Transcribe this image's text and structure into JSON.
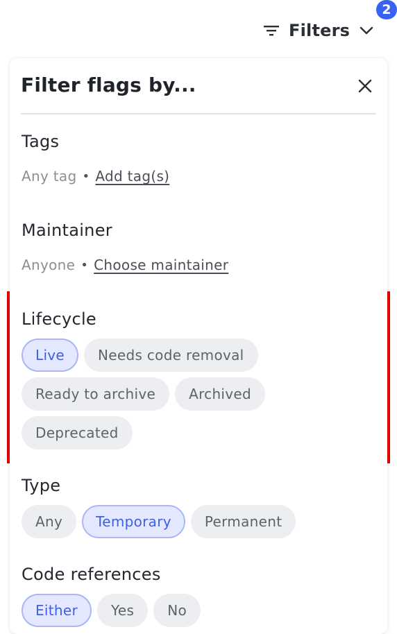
{
  "header": {
    "filters_label": "Filters",
    "active_count": "2"
  },
  "panel": {
    "title": "Filter flags by...",
    "tags": {
      "title": "Tags",
      "current": "Any tag",
      "separator": "•",
      "action": "Add tag(s)"
    },
    "maintainer": {
      "title": "Maintainer",
      "current": "Anyone",
      "separator": "•",
      "action": "Choose maintainer"
    },
    "lifecycle": {
      "title": "Lifecycle",
      "options": [
        "Live",
        "Needs code removal",
        "Ready to archive",
        "Archived",
        "Deprecated"
      ],
      "selected": "Live"
    },
    "type": {
      "title": "Type",
      "options": [
        "Any",
        "Temporary",
        "Permanent"
      ],
      "selected": "Temporary"
    },
    "code_references": {
      "title": "Code references",
      "options": [
        "Either",
        "Yes",
        "No"
      ],
      "selected": "Either"
    }
  },
  "colors": {
    "accent": "#3a62f0",
    "highlight_border": "#e00000",
    "chip_bg": "#eceef1",
    "chip_selected_bg": "#e5e9ff"
  }
}
